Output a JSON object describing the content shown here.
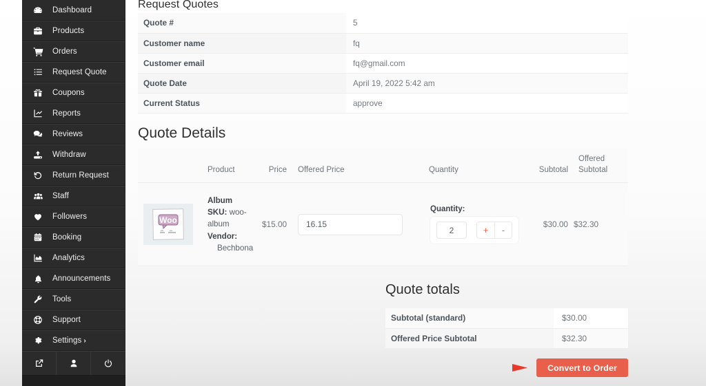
{
  "sidebar": {
    "items": [
      {
        "label": "Dashboard",
        "icon": "dashboard-icon"
      },
      {
        "label": "Products",
        "icon": "briefcase-icon"
      },
      {
        "label": "Orders",
        "icon": "cart-icon"
      },
      {
        "label": "Request Quote",
        "icon": "list-icon"
      },
      {
        "label": "Coupons",
        "icon": "gift-icon"
      },
      {
        "label": "Reports",
        "icon": "chart-line-icon"
      },
      {
        "label": "Reviews",
        "icon": "comments-icon"
      },
      {
        "label": "Withdraw",
        "icon": "upload-icon"
      },
      {
        "label": "Return Request",
        "icon": "undo-icon"
      },
      {
        "label": "Staff",
        "icon": "users-icon"
      },
      {
        "label": "Followers",
        "icon": "heart-icon"
      },
      {
        "label": "Booking",
        "icon": "calendar-icon"
      },
      {
        "label": "Analytics",
        "icon": "chart-area-icon"
      },
      {
        "label": "Announcements",
        "icon": "bell-icon"
      },
      {
        "label": "Tools",
        "icon": "wrench-icon"
      },
      {
        "label": "Support",
        "icon": "lifebuoy-icon"
      },
      {
        "label": "Settings",
        "icon": "gear-icon",
        "chevron": "›"
      }
    ],
    "footer": [
      {
        "icon": "external-link-icon"
      },
      {
        "icon": "user-icon"
      },
      {
        "icon": "power-icon"
      }
    ]
  },
  "page": {
    "title": "Request Quotes",
    "details_title": "Quote Details",
    "totals_title": "Quote totals"
  },
  "info_rows": [
    {
      "key": "Quote #",
      "value": "5"
    },
    {
      "key": "Customer name",
      "value": "fq"
    },
    {
      "key": "Customer email",
      "value": "fq@gmail.com"
    },
    {
      "key": "Quote Date",
      "value": "April 19, 2022 5:42 am"
    },
    {
      "key": "Current Status",
      "value": "approve"
    }
  ],
  "details": {
    "headers": {
      "thumb": "",
      "product": "Product",
      "price": "Price",
      "offered_price": "Offered Price",
      "quantity": "Quantity",
      "subtotal": "Subtotal",
      "offered_subtotal": "Offered\nSubtotal"
    },
    "row": {
      "thumb_alt": "woo-album-thumbnail",
      "product_name": "Album",
      "sku_label": "SKU:",
      "sku_value": "woo-album",
      "vendor_label": "Vendor:",
      "vendor_value": "Bechbona",
      "price": "$15.00",
      "offered_price_value": "16.15",
      "offered_price_placeholder": "Offered Price",
      "quantity_label": "Quantity:",
      "quantity_value": "2",
      "plus_label": "+",
      "minus_label": "-",
      "subtotal": "$30.00",
      "offered_subtotal": "$32.30"
    }
  },
  "totals": {
    "rows": [
      {
        "key": "Subtotal (standard)",
        "value": "$30.00"
      },
      {
        "key": "Offered Price Subtotal",
        "value": "$32.30"
      }
    ],
    "convert_button": "Convert to Order"
  },
  "colors": {
    "sidebar_bg": "#2b2b2b",
    "accent": "#e8604c",
    "annotation_red": "#e8392a",
    "stepper_icon": "#ef5b45"
  }
}
